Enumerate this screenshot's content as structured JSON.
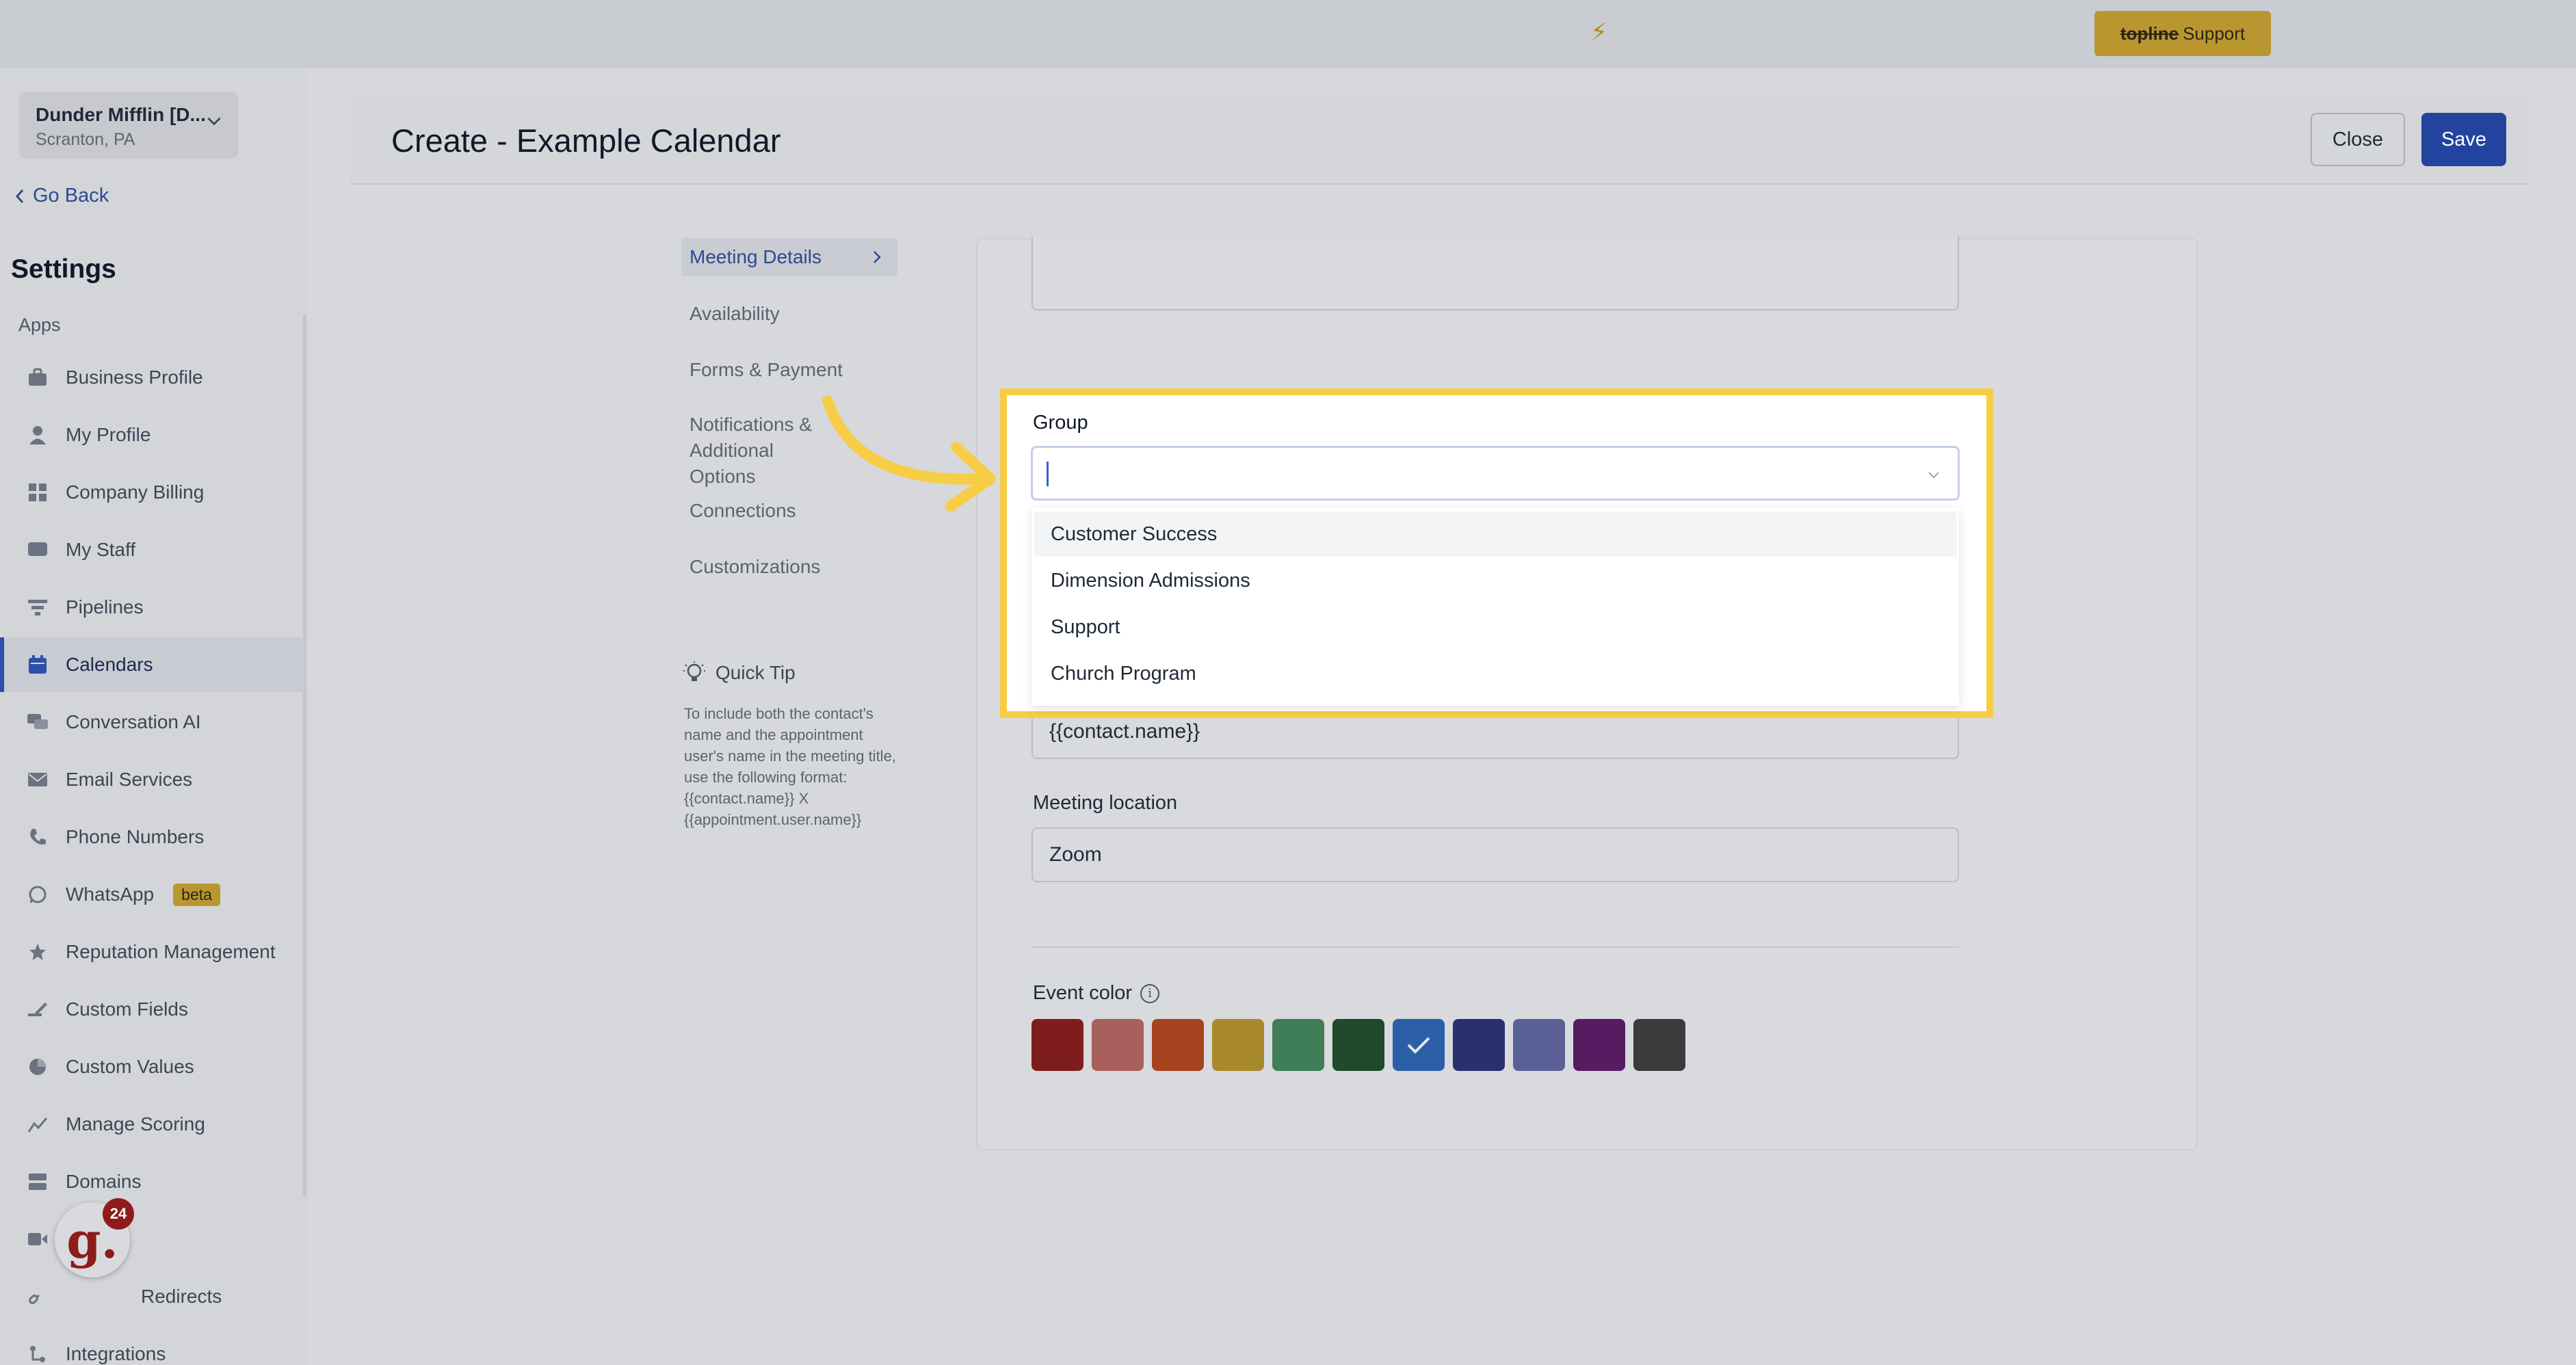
{
  "topbar": {
    "support_brand": "topline",
    "support_label": "Support"
  },
  "location": {
    "name": "Dunder Mifflin [D...",
    "city": "Scranton, PA"
  },
  "sidebar": {
    "go_back": "Go Back",
    "title": "Settings",
    "section": "Apps",
    "items": [
      {
        "label": "Business Profile",
        "icon": "briefcase-icon"
      },
      {
        "label": "My Profile",
        "icon": "user-icon"
      },
      {
        "label": "Company Billing",
        "icon": "grid-icon"
      },
      {
        "label": "My Staff",
        "icon": "staff-icon"
      },
      {
        "label": "Pipelines",
        "icon": "filter-icon"
      },
      {
        "label": "Calendars",
        "icon": "calendar-icon"
      },
      {
        "label": "Conversation AI",
        "icon": "chat-icon"
      },
      {
        "label": "Email Services",
        "icon": "mail-icon"
      },
      {
        "label": "Phone Numbers",
        "icon": "phone-icon"
      },
      {
        "label": "WhatsApp",
        "icon": "whatsapp-icon",
        "badge": "beta"
      },
      {
        "label": "Reputation Management",
        "icon": "star-icon"
      },
      {
        "label": "Custom Fields",
        "icon": "edit-icon"
      },
      {
        "label": "Custom Values",
        "icon": "pie-icon"
      },
      {
        "label": "Manage Scoring",
        "icon": "chart-icon"
      },
      {
        "label": "Domains",
        "icon": "server-icon"
      },
      {
        "label": "",
        "icon": "video-icon"
      },
      {
        "label": "Redirects",
        "icon": "link-icon"
      },
      {
        "label": "Integrations",
        "icon": "integrations-icon"
      }
    ],
    "notification_count": "24",
    "avatar_letter": "g."
  },
  "header": {
    "title": "Create - Example Calendar",
    "close_label": "Close",
    "save_label": "Save"
  },
  "subnav": {
    "items": [
      "Meeting Details",
      "Availability",
      "Forms & Payment",
      "Notifications & Additional Options",
      "Connections",
      "Customizations"
    ],
    "active": 0
  },
  "quick_tip": {
    "title": "Quick Tip",
    "body": "To include both the contact's name and the appointment user's name in the meeting title, use the following format: {{contact.name}} X {{appointment.user.name}}"
  },
  "form": {
    "group_label": "Group",
    "group_value": "",
    "group_options": [
      "Customer Success",
      "Dimension Admissions",
      "Support",
      "Church Program"
    ],
    "meeting_title_value": "{{contact.name}}",
    "location_label": "Meeting location",
    "location_value": "Zoom",
    "event_color_label": "Event color",
    "event_colors": [
      "#7f1d1d",
      "#a8605c",
      "#a5441f",
      "#a88a2c",
      "#3f7e56",
      "#1f4a2b",
      "#2b5fa8",
      "#2a2f6e",
      "#5a5f95",
      "#561c62",
      "#3a3b3d"
    ],
    "selected_color_index": 6
  }
}
